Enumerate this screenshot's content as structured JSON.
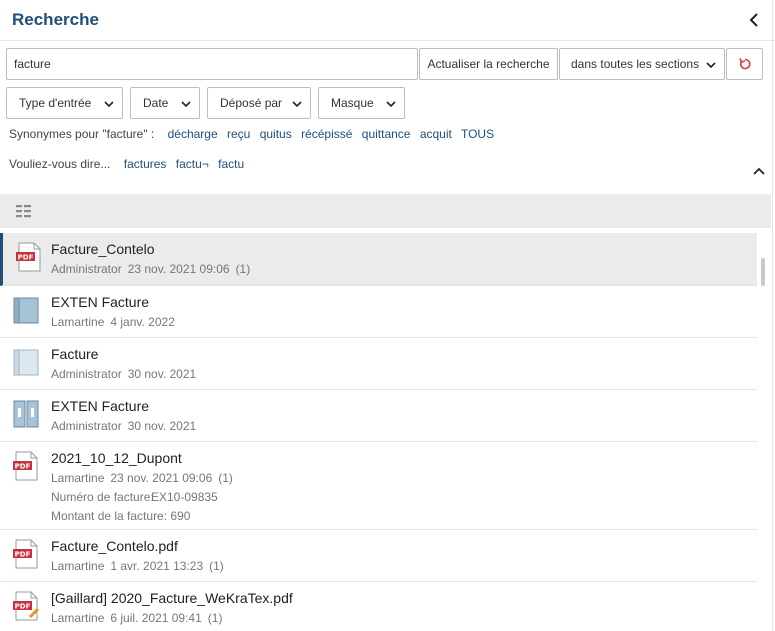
{
  "panel": {
    "title": "Recherche"
  },
  "search": {
    "query": "facture",
    "refresh_label": "Actualiser la recherche",
    "sections_label": "dans toutes les sections"
  },
  "filters": [
    {
      "label": "Type d'entrée"
    },
    {
      "label": "Date"
    },
    {
      "label": "Déposé par"
    },
    {
      "label": "Masque"
    }
  ],
  "synonyms": {
    "label": "Synonymes pour \"facture\" :",
    "items": [
      "décharge",
      "reçu",
      "quitus",
      "récépissé",
      "quittance",
      "acquit",
      "TOUS"
    ]
  },
  "did_you_mean": {
    "label": "Vouliez-vous dire...",
    "items": [
      "factures",
      "factu¬",
      "factu"
    ]
  },
  "results": [
    {
      "name": "Facture_Contelo",
      "icon": "pdf-icon",
      "author": "Administrator",
      "date": "23 nov. 2021 09:06",
      "count": "(1)",
      "selected": true
    },
    {
      "name": "EXTEN Facture",
      "icon": "folder-dark-icon",
      "author": "Lamartine",
      "date": "4 janv. 2022",
      "count": ""
    },
    {
      "name": "Facture",
      "icon": "folder-light-icon",
      "author": "Administrator",
      "date": "30 nov. 2021",
      "count": ""
    },
    {
      "name": "EXTEN Facture",
      "icon": "binder-icon",
      "author": "Administrator",
      "date": "30 nov. 2021",
      "count": ""
    },
    {
      "name": "2021_10_12_Dupont",
      "icon": "pdf-icon",
      "author": "Lamartine",
      "date": "23 nov. 2021 09:06",
      "count": "(1)",
      "fields": [
        {
          "label": "Numéro de facture:",
          "value": "EX10-09835"
        },
        {
          "label": "Montant de la facture:",
          "value": "690"
        }
      ]
    },
    {
      "name": "Facture_Contelo.pdf",
      "icon": "pdf-icon",
      "author": "Lamartine",
      "date": "1 avr. 2021 13:23",
      "count": "(1)"
    },
    {
      "name": "[Gaillard] 2020_Facture_WeKraTex.pdf",
      "icon": "pdf-edit-icon",
      "author": "Lamartine",
      "date": "6 juil. 2021 09:41",
      "count": "(1)"
    }
  ],
  "colors": {
    "accent": "#1f4e79",
    "pdf_red": "#c8323c",
    "reset_red": "#d23c3c"
  }
}
